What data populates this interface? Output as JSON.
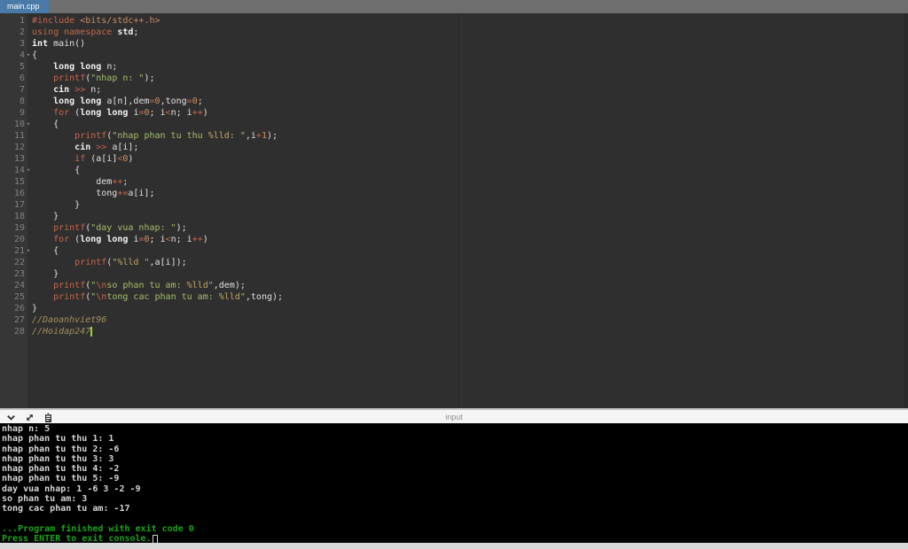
{
  "tab_bar": {
    "active_tab": "main.cpp"
  },
  "colors": {
    "tab_active_bg": "#4a7aa8",
    "editor_bg": "#2f2f2f",
    "keyword": "#c4684e",
    "string": "#a5bd68",
    "number": "#cf9362",
    "comment": "#a2905f",
    "console_ok": "#1ba41b",
    "caret": "#9ed334"
  },
  "editor": {
    "lines": [
      {
        "n": 1,
        "fold": false,
        "seg": [
          [
            "kw",
            "#include"
          ],
          [
            "pl",
            " "
          ],
          [
            "inc",
            "<bits/stdc++.h>"
          ]
        ]
      },
      {
        "n": 2,
        "fold": false,
        "seg": [
          [
            "kw",
            "using"
          ],
          [
            "pl",
            " "
          ],
          [
            "kw",
            "namespace"
          ],
          [
            "pl",
            " "
          ],
          [
            "ty",
            "std"
          ],
          [
            "pl",
            ";"
          ]
        ]
      },
      {
        "n": 3,
        "fold": false,
        "seg": [
          [
            "ty",
            "int"
          ],
          [
            "pl",
            " main()"
          ]
        ]
      },
      {
        "n": 4,
        "fold": true,
        "seg": [
          [
            "pl",
            "{"
          ]
        ]
      },
      {
        "n": 5,
        "fold": false,
        "seg": [
          [
            "pl",
            "    "
          ],
          [
            "ty",
            "long"
          ],
          [
            "pl",
            " "
          ],
          [
            "ty",
            "long"
          ],
          [
            "pl",
            " n;"
          ]
        ]
      },
      {
        "n": 6,
        "fold": false,
        "seg": [
          [
            "pl",
            "    "
          ],
          [
            "kw",
            "printf"
          ],
          [
            "pl",
            "("
          ],
          [
            "str",
            "\"nhap n: \""
          ],
          [
            "pl",
            ");"
          ]
        ]
      },
      {
        "n": 7,
        "fold": false,
        "seg": [
          [
            "pl",
            "    "
          ],
          [
            "ty",
            "cin"
          ],
          [
            "pl",
            " "
          ],
          [
            "op",
            ">>"
          ],
          [
            "pl",
            " n;"
          ]
        ]
      },
      {
        "n": 8,
        "fold": false,
        "seg": [
          [
            "pl",
            "    "
          ],
          [
            "ty",
            "long"
          ],
          [
            "pl",
            " "
          ],
          [
            "ty",
            "long"
          ],
          [
            "pl",
            " a[n],dem"
          ],
          [
            "op",
            "="
          ],
          [
            "num",
            "0"
          ],
          [
            "pl",
            ",tong"
          ],
          [
            "op",
            "="
          ],
          [
            "num",
            "0"
          ],
          [
            "pl",
            ";"
          ]
        ]
      },
      {
        "n": 9,
        "fold": false,
        "seg": [
          [
            "pl",
            "    "
          ],
          [
            "kw",
            "for"
          ],
          [
            "pl",
            " ("
          ],
          [
            "ty",
            "long"
          ],
          [
            "pl",
            " "
          ],
          [
            "ty",
            "long"
          ],
          [
            "pl",
            " i"
          ],
          [
            "op",
            "="
          ],
          [
            "num",
            "0"
          ],
          [
            "pl",
            "; i"
          ],
          [
            "op",
            "<"
          ],
          [
            "pl",
            "n; i"
          ],
          [
            "op",
            "++"
          ],
          [
            "pl",
            ")"
          ]
        ]
      },
      {
        "n": 10,
        "fold": true,
        "seg": [
          [
            "pl",
            "    {"
          ]
        ]
      },
      {
        "n": 11,
        "fold": false,
        "seg": [
          [
            "pl",
            "        "
          ],
          [
            "kw",
            "printf"
          ],
          [
            "pl",
            "("
          ],
          [
            "str",
            "\"nhap phan tu thu "
          ],
          [
            "fmt",
            "%lld"
          ],
          [
            "str",
            ": \""
          ],
          [
            "pl",
            ",i"
          ],
          [
            "op",
            "+"
          ],
          [
            "num",
            "1"
          ],
          [
            "pl",
            ");"
          ]
        ]
      },
      {
        "n": 12,
        "fold": false,
        "seg": [
          [
            "pl",
            "        "
          ],
          [
            "ty",
            "cin"
          ],
          [
            "pl",
            " "
          ],
          [
            "op",
            ">>"
          ],
          [
            "pl",
            " a[i];"
          ]
        ]
      },
      {
        "n": 13,
        "fold": false,
        "seg": [
          [
            "pl",
            "        "
          ],
          [
            "kw",
            "if"
          ],
          [
            "pl",
            " (a[i]"
          ],
          [
            "op",
            "<"
          ],
          [
            "num",
            "0"
          ],
          [
            "pl",
            ")"
          ]
        ]
      },
      {
        "n": 14,
        "fold": true,
        "seg": [
          [
            "pl",
            "        {"
          ]
        ]
      },
      {
        "n": 15,
        "fold": false,
        "seg": [
          [
            "pl",
            "            dem"
          ],
          [
            "op",
            "++"
          ],
          [
            "pl",
            ";"
          ]
        ]
      },
      {
        "n": 16,
        "fold": false,
        "seg": [
          [
            "pl",
            "            tong"
          ],
          [
            "op",
            "+="
          ],
          [
            "pl",
            "a[i];"
          ]
        ]
      },
      {
        "n": 17,
        "fold": false,
        "seg": [
          [
            "pl",
            "        }"
          ]
        ]
      },
      {
        "n": 18,
        "fold": false,
        "seg": [
          [
            "pl",
            "    }"
          ]
        ]
      },
      {
        "n": 19,
        "fold": false,
        "seg": [
          [
            "pl",
            "    "
          ],
          [
            "kw",
            "printf"
          ],
          [
            "pl",
            "("
          ],
          [
            "str",
            "\"day vua nhap: \""
          ],
          [
            "pl",
            ");"
          ]
        ]
      },
      {
        "n": 20,
        "fold": false,
        "seg": [
          [
            "pl",
            "    "
          ],
          [
            "kw",
            "for"
          ],
          [
            "pl",
            " ("
          ],
          [
            "ty",
            "long"
          ],
          [
            "pl",
            " "
          ],
          [
            "ty",
            "long"
          ],
          [
            "pl",
            " i"
          ],
          [
            "op",
            "="
          ],
          [
            "num",
            "0"
          ],
          [
            "pl",
            "; i"
          ],
          [
            "op",
            "<"
          ],
          [
            "pl",
            "n; i"
          ],
          [
            "op",
            "++"
          ],
          [
            "pl",
            ")"
          ]
        ]
      },
      {
        "n": 21,
        "fold": true,
        "seg": [
          [
            "pl",
            "    {"
          ]
        ]
      },
      {
        "n": 22,
        "fold": false,
        "seg": [
          [
            "pl",
            "        "
          ],
          [
            "kw",
            "printf"
          ],
          [
            "pl",
            "("
          ],
          [
            "str",
            "\""
          ],
          [
            "fmt",
            "%lld"
          ],
          [
            "str",
            " \""
          ],
          [
            "pl",
            ",a[i]);"
          ]
        ]
      },
      {
        "n": 23,
        "fold": false,
        "seg": [
          [
            "pl",
            "    }"
          ]
        ]
      },
      {
        "n": 24,
        "fold": false,
        "seg": [
          [
            "pl",
            "    "
          ],
          [
            "kw",
            "printf"
          ],
          [
            "pl",
            "("
          ],
          [
            "str",
            "\""
          ],
          [
            "esc",
            "\\n"
          ],
          [
            "str",
            "so phan tu am: "
          ],
          [
            "fmt",
            "%lld"
          ],
          [
            "str",
            "\""
          ],
          [
            "pl",
            ",dem);"
          ]
        ]
      },
      {
        "n": 25,
        "fold": false,
        "seg": [
          [
            "pl",
            "    "
          ],
          [
            "kw",
            "printf"
          ],
          [
            "pl",
            "("
          ],
          [
            "str",
            "\""
          ],
          [
            "esc",
            "\\n"
          ],
          [
            "str",
            "tong cac phan tu am: "
          ],
          [
            "fmt",
            "%lld"
          ],
          [
            "str",
            "\""
          ],
          [
            "pl",
            ",tong);"
          ]
        ]
      },
      {
        "n": 26,
        "fold": false,
        "seg": [
          [
            "pl",
            "}"
          ]
        ]
      },
      {
        "n": 27,
        "fold": false,
        "seg": [
          [
            "com",
            "//Daoanhviet96"
          ]
        ]
      },
      {
        "n": 28,
        "fold": false,
        "caret": true,
        "seg": [
          [
            "com",
            "//Hoidap247"
          ]
        ]
      }
    ]
  },
  "console": {
    "header_label": "input",
    "icons": [
      "chevron-down",
      "expand",
      "paste"
    ],
    "lines": [
      {
        "text": "nhap n: 5",
        "type": "out"
      },
      {
        "text": "nhap phan tu thu 1: 1",
        "type": "out"
      },
      {
        "text": "nhap phan tu thu 2: -6",
        "type": "out"
      },
      {
        "text": "nhap phan tu thu 3: 3",
        "type": "out"
      },
      {
        "text": "nhap phan tu thu 4: -2",
        "type": "out"
      },
      {
        "text": "nhap phan tu thu 5: -9",
        "type": "out"
      },
      {
        "text": "day vua nhap: 1 -6 3 -2 -9",
        "type": "out"
      },
      {
        "text": "so phan tu am: 3",
        "type": "out"
      },
      {
        "text": "tong cac phan tu am: -17",
        "type": "out"
      },
      {
        "text": "",
        "type": "out"
      },
      {
        "text": "...Program finished with exit code 0",
        "type": "ok"
      },
      {
        "text": "Press ENTER to exit console.",
        "type": "ok",
        "cursor": true
      }
    ]
  }
}
